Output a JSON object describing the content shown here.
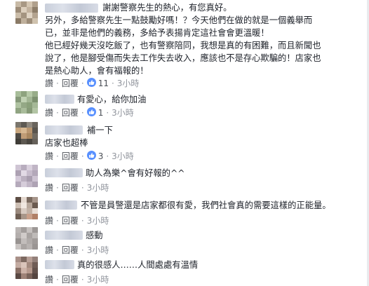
{
  "colors": {
    "like_badge": "#5890ff",
    "action_text": "#4b4f56",
    "meta_text": "#90949c",
    "body_text": "#1d2129"
  },
  "actions": {
    "like": "讚",
    "reply": "回覆",
    "sep": "·"
  },
  "comments": [
    {
      "lines": [
        "謝謝警察先生的熱心，有您真好。",
        "另外，多給警察先生一點鼓勵好嗎！？今天他們在做的就是一個義舉而",
        "已，並非是他們的義務，多給予表揚肯定這社會會更溫暖！",
        "他已經好幾天沒吃飯了，也有警察陪同，我想是真的有困難，而且新聞也",
        "說了，他是腳受傷而失去工作失去收入，應該也不是存心欺騙的！店家也",
        "是熱心助人，會有福報的！"
      ],
      "likes": "11",
      "time": "3小時"
    },
    {
      "lines": [
        "有愛心，給你加油"
      ],
      "likes": "1",
      "time": "3小時"
    },
    {
      "lines": [
        "補一下",
        "店家也超棒"
      ],
      "likes": "3",
      "time": "3小時"
    },
    {
      "lines": [
        "助人為樂^會有好報的^^"
      ],
      "likes": "",
      "time": "3小時"
    },
    {
      "lines": [
        "不管是員警還是店家都很有愛，我們社會真的需要這樣的正能量。"
      ],
      "likes": "",
      "time": "3小時"
    },
    {
      "lines": [
        "感動"
      ],
      "likes": "",
      "time": "3小時"
    },
    {
      "lines": [
        "真的很感人……人間處處有溫情"
      ],
      "likes": "",
      "time": "3小時"
    }
  ]
}
